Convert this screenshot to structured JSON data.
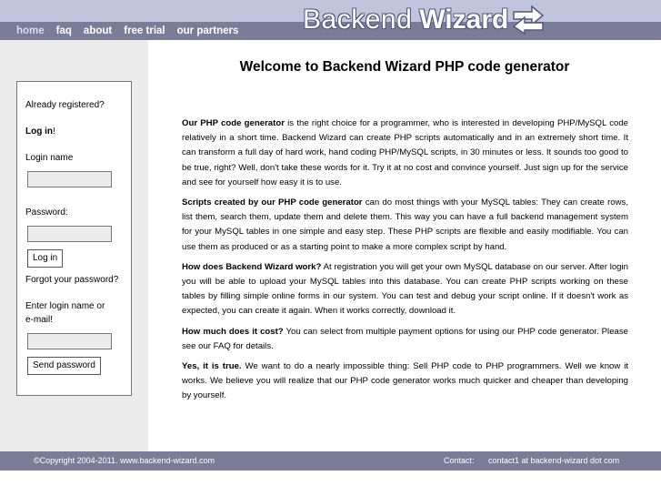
{
  "nav": {
    "items": [
      {
        "label": "home"
      },
      {
        "label": "faq"
      },
      {
        "label": "about"
      },
      {
        "label": "free trial"
      },
      {
        "label": "our partners"
      }
    ]
  },
  "logo": {
    "part1": "Backend",
    "part2": "Wizard",
    "icon": "double-arrow-icon"
  },
  "login": {
    "already_registered": "Already registered?",
    "log_in_bold": "Log in",
    "log_in_suffix": "!",
    "login_name_label": "Login name",
    "login_name_value": "",
    "password_label": "Password:",
    "password_value": "",
    "login_button": "Log in",
    "forgot_password": "Forgot your password?",
    "enter_login_line1": "Enter login name or",
    "enter_login_line2": "e-mail!",
    "recovery_value": "",
    "send_password_button": "Send password"
  },
  "main": {
    "title": "Welcome to Backend Wizard PHP code generator",
    "paragraphs": [
      {
        "bold": "Our PHP code generator",
        "text": " is the right choice for a programmer, who is interested in developing PHP/MySQL code relatively in a short time. Backend Wizard can create PHP scripts automatically and in an extremely short time. It can transform a full day of hard work, hand coding PHP/MySQL scripts, in 30 minutes or less. It sounds too good to be true, right? Well, don't take these words for it. Try it at no cost and convince yourself. Just sign up for the service and see for yourself how easy it is to use."
      },
      {
        "bold": "Scripts created by our PHP code generator",
        "text": " can do most things with your MySQL tables: They can create rows, list them, search them, update them and delete them. This way you can have a full backend management system for your MySQL tables in one simple and easy step. These PHP scripts are flexible and easily modifiable. You can use them as produced or as a starting point to make a more complex script by hand."
      },
      {
        "bold": "How does Backend Wizard work?",
        "text": " At registration you will get your own MySQL database on our server. After login you will be able to upload your MySQL tables into this database. You can create PHP scripts working on these tables by filling simple online forms in our system. You can test and debug your script online. If it doesn't work as expected, you can create it again. When it works correctly, download it."
      },
      {
        "bold": "How much does it cost?",
        "text": " You can select from multiple payment options for using our PHP code generator. Please see our FAQ for details."
      },
      {
        "bold": "Yes, it is true.",
        "text": " We want to do a nearly impossible thing: Sell PHP code to PHP programmers. Well we know it works. We believe you will realize that our PHP code generator works much quicker and cheaper than developing by yourself."
      }
    ]
  },
  "footer": {
    "copyright": "©Copyright 2004-2011. www.backend-wizard.com",
    "contact_label": "Contact:",
    "contact_email": "contact1 at backend-wizard dot com"
  },
  "colors": {
    "header_light": "#c0c4dd",
    "bar_dark": "#7a7c98",
    "sidebar_bg": "#ececec"
  }
}
